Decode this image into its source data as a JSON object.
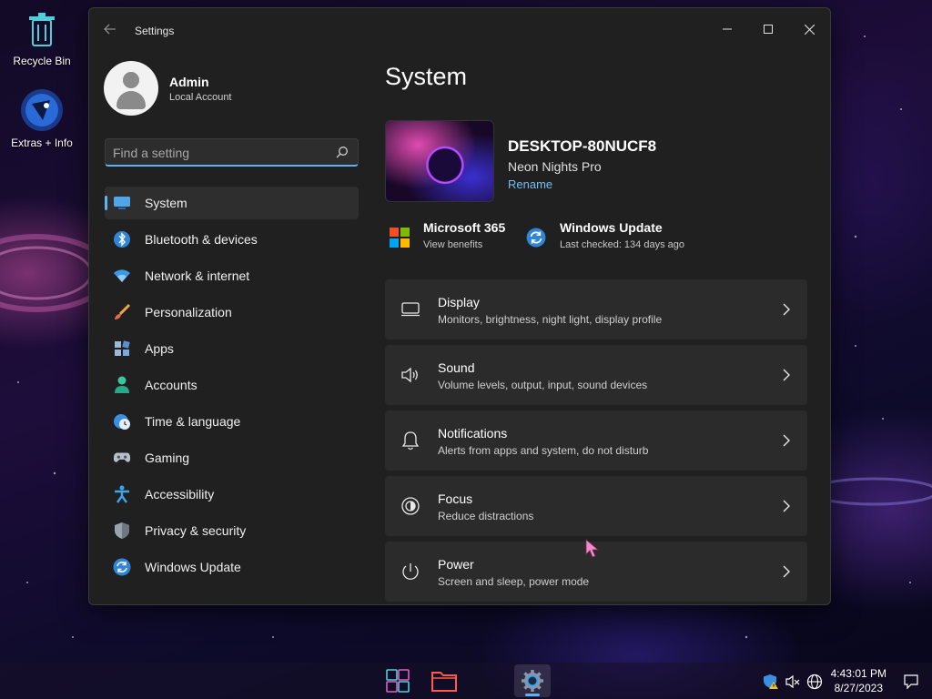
{
  "desktop": {
    "icons": [
      {
        "label": "Recycle Bin",
        "icon": "recycle-bin-icon"
      },
      {
        "label": "Extras + Info",
        "icon": "extras-icon"
      }
    ]
  },
  "window": {
    "title": "Settings",
    "controls": [
      "minimize-icon",
      "maximize-icon",
      "close-icon"
    ]
  },
  "profile": {
    "name": "Admin",
    "account_type": "Local Account"
  },
  "search": {
    "placeholder": "Find a setting"
  },
  "sidebar": {
    "items": [
      {
        "label": "System",
        "icon": "system-icon",
        "active": true
      },
      {
        "label": "Bluetooth & devices",
        "icon": "bluetooth-icon"
      },
      {
        "label": "Network & internet",
        "icon": "wifi-icon"
      },
      {
        "label": "Personalization",
        "icon": "brush-icon"
      },
      {
        "label": "Apps",
        "icon": "apps-icon"
      },
      {
        "label": "Accounts",
        "icon": "person-icon"
      },
      {
        "label": "Time & language",
        "icon": "globe-clock-icon"
      },
      {
        "label": "Gaming",
        "icon": "controller-icon"
      },
      {
        "label": "Accessibility",
        "icon": "accessibility-icon"
      },
      {
        "label": "Privacy & security",
        "icon": "shield-icon"
      },
      {
        "label": "Windows Update",
        "icon": "update-icon"
      }
    ]
  },
  "main": {
    "title": "System",
    "device": {
      "name": "DESKTOP-80NUCF8",
      "model": "Neon Nights Pro",
      "rename_label": "Rename"
    },
    "quick_links": [
      {
        "title": "Microsoft 365",
        "subtitle": "View benefits",
        "icon": "microsoft-logo-icon"
      },
      {
        "title": "Windows Update",
        "subtitle": "Last checked: 134 days ago",
        "icon": "update-icon"
      }
    ],
    "cards": [
      {
        "title": "Display",
        "subtitle": "Monitors, brightness, night light, display profile",
        "icon": "monitor-icon"
      },
      {
        "title": "Sound",
        "subtitle": "Volume levels, output, input, sound devices",
        "icon": "speaker-icon"
      },
      {
        "title": "Notifications",
        "subtitle": "Alerts from apps and system, do not disturb",
        "icon": "bell-icon"
      },
      {
        "title": "Focus",
        "subtitle": "Reduce distractions",
        "icon": "focus-icon"
      },
      {
        "title": "Power",
        "subtitle": "Screen and sleep, power mode",
        "icon": "power-icon"
      }
    ]
  },
  "taskbar": {
    "buttons": [
      "start-icon",
      "file-explorer-icon",
      "settings-icon"
    ],
    "active_button": "settings-icon",
    "tray": [
      "security-warning-icon",
      "volume-muted-icon",
      "network-globe-icon"
    ],
    "time": "4:43:01 PM",
    "date": "8/27/2023",
    "notification_icon": "notification-icon"
  },
  "colors": {
    "accent": "#5fb2f2",
    "window_bg": "#202020",
    "card_bg": "#2b2b2b",
    "link": "#74bdf5"
  }
}
